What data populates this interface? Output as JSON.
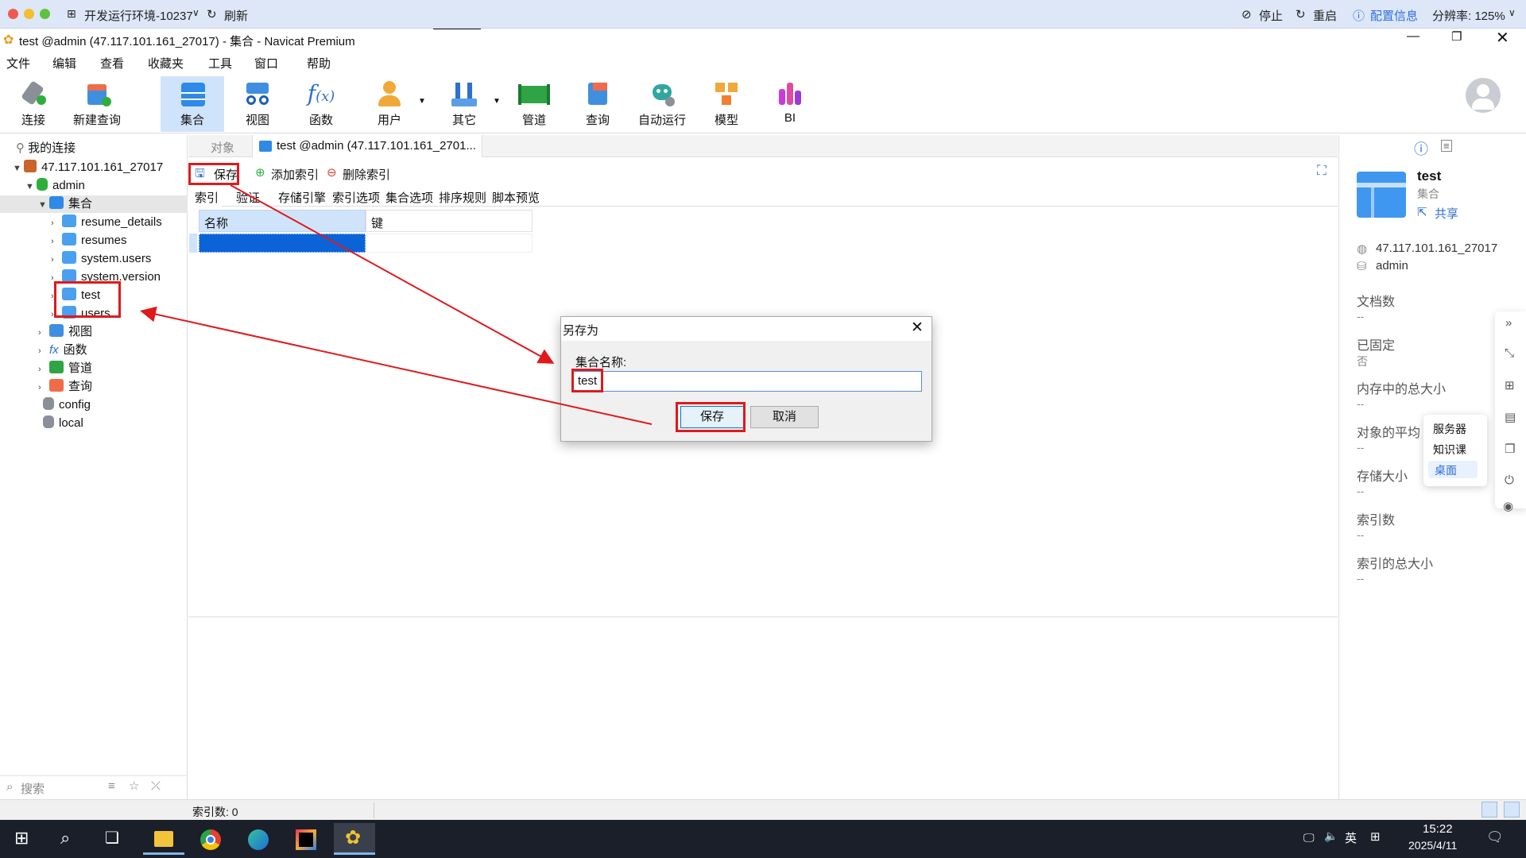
{
  "remote_bar": {
    "env_label": "开发运行环境-10237",
    "refresh": "刷新",
    "stop": "停止",
    "restart": "重启",
    "config_info": "配置信息",
    "resolution": "分辨率: 125%"
  },
  "window": {
    "title": "test @admin (47.117.101.161_27017) - 集合 - Navicat Premium"
  },
  "menu": [
    "文件",
    "编辑",
    "查看",
    "收藏夹",
    "工具",
    "窗口",
    "帮助"
  ],
  "toolbar": [
    {
      "label": "连接"
    },
    {
      "label": "新建查询"
    },
    {
      "label": "集合"
    },
    {
      "label": "视图"
    },
    {
      "label": "函数"
    },
    {
      "label": "用户"
    },
    {
      "label": "其它"
    },
    {
      "label": "管道"
    },
    {
      "label": "查询"
    },
    {
      "label": "自动运行"
    },
    {
      "label": "模型"
    },
    {
      "label": "BI"
    }
  ],
  "tree": {
    "my_connections": "我的连接",
    "connection": "47.117.101.161_27017",
    "db_admin": "admin",
    "collections": "集合",
    "items": [
      "resume_details",
      "resumes",
      "system.users",
      "system.version",
      "test",
      "users"
    ],
    "views": "视图",
    "functions": "函数",
    "pipelines": "管道",
    "queries": "查询",
    "db_config": "config",
    "db_local": "local",
    "search_placeholder": "搜索"
  },
  "tabs": {
    "objects": "对象",
    "active": "test @admin (47.117.101.161_2701..."
  },
  "subtoolbar": {
    "save": "保存",
    "add_index": "添加索引",
    "delete_index": "删除索引"
  },
  "subtabs": [
    "索引",
    "验证",
    "存储引擎",
    "索引选项",
    "集合选项",
    "排序规则",
    "脚本预览"
  ],
  "grid": {
    "col_name": "名称",
    "col_key": "键"
  },
  "status": {
    "index_count": "索引数: 0"
  },
  "right_panel": {
    "name": "test",
    "type": "集合",
    "share": "共享",
    "server": "47.117.101.161_27017",
    "db": "admin",
    "fields": [
      {
        "label": "文档数",
        "value": "--"
      },
      {
        "label": "已固定",
        "value": "否"
      },
      {
        "label": "内存中的总大小",
        "value": "--"
      },
      {
        "label": "对象的平均",
        "value": "--"
      },
      {
        "label": "存储大小",
        "value": "--"
      },
      {
        "label": "索引数",
        "value": "--"
      },
      {
        "label": "索引的总大小",
        "value": "--"
      }
    ],
    "popup": [
      "服务器",
      "知识课",
      "桌面"
    ]
  },
  "dialog": {
    "title": "另存为",
    "label": "集合名称:",
    "value": "test",
    "save": "保存",
    "cancel": "取消"
  },
  "taskbar": {
    "lang": "英",
    "time": "15:22",
    "date": "2025/4/11"
  },
  "colors": {
    "annotation_red": "#e0191b",
    "accent_blue": "#2f6fe0",
    "selection_blue": "#0a64d8"
  }
}
